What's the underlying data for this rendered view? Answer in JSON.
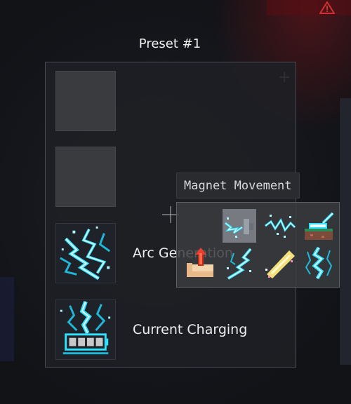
{
  "preset": {
    "title": "Preset #1",
    "slots": [
      {
        "label": "",
        "icon": "empty-slot"
      },
      {
        "label": "",
        "icon": "empty-slot"
      },
      {
        "label": "Arc Generation",
        "icon": "arc-generation-icon"
      },
      {
        "label": "Current Charging",
        "icon": "current-charging-icon"
      }
    ]
  },
  "tooltip": {
    "text": "Magnet Movement"
  },
  "picker": {
    "selected": "magnet-movement",
    "items": [
      {
        "name": "magnet-movement",
        "icon": "magnet-movement-icon"
      },
      {
        "name": "electric-dash",
        "icon": "electric-dash-icon"
      },
      {
        "name": "railgun",
        "icon": "railgun-icon"
      },
      {
        "name": "power-uppercut",
        "icon": "uppercut-icon"
      },
      {
        "name": "lightning-strike",
        "icon": "lightning-strike-icon"
      },
      {
        "name": "plasma-beam",
        "icon": "plasma-beam-icon"
      },
      {
        "name": "thunder-column",
        "icon": "thunder-column-icon"
      }
    ]
  },
  "colors": {
    "electric": "#2fe0ff",
    "electric_light": "#c8fbff",
    "panel_bg": "#1e1f24",
    "picker_bg": "#3a3c40",
    "hud_warning": "#d03030"
  }
}
